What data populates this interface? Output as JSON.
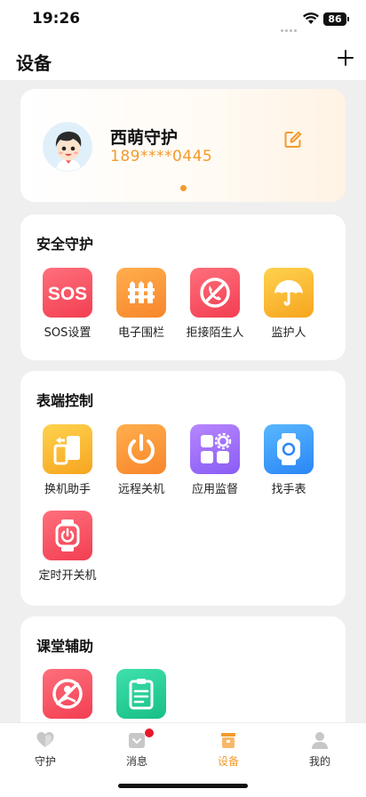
{
  "status_bar": {
    "time": "19:26",
    "battery": "86"
  },
  "header": {
    "title": "设备",
    "add_icon": "plus-icon"
  },
  "profile": {
    "name": "西萌守护",
    "phone": "189****0445",
    "avatar_icon": "child-avatar",
    "edit_icon": "edit-icon",
    "pager": {
      "current": 1,
      "total": 1
    }
  },
  "sections": {
    "safety": {
      "title": "安全守护",
      "items": [
        {
          "label": "SOS设置",
          "icon": "sos-icon",
          "color": "#f23f52"
        },
        {
          "label": "电子围栏",
          "icon": "fence-icon",
          "color": "#f7862a"
        },
        {
          "label": "拒接陌生人",
          "icon": "block-call-icon",
          "color": "#f23f52"
        },
        {
          "label": "监护人",
          "icon": "umbrella-icon",
          "color": "#f6a51f"
        }
      ]
    },
    "watch_control": {
      "title": "表端控制",
      "items": [
        {
          "label": "换机助手",
          "icon": "phone-switch-icon",
          "color": "#f6a51f"
        },
        {
          "label": "远程关机",
          "icon": "power-icon",
          "color": "#f7862a"
        },
        {
          "label": "应用监督",
          "icon": "apps-gear-icon",
          "color": "#8a5cf5"
        },
        {
          "label": "找手表",
          "icon": "watch-icon",
          "color": "#2a86f5"
        },
        {
          "label": "定时开关机",
          "icon": "timer-power-icon",
          "color": "#f23f52"
        }
      ]
    },
    "classroom": {
      "title": "课堂辅助",
      "items": [
        {
          "icon": "no-study-icon",
          "color": "#f23f52"
        },
        {
          "icon": "clipboard-icon",
          "color": "#17bf85"
        }
      ]
    }
  },
  "tab_bar": {
    "tabs": [
      {
        "label": "守护",
        "icon": "heart-icon",
        "active": false
      },
      {
        "label": "消息",
        "icon": "message-icon",
        "active": false,
        "badge": true
      },
      {
        "label": "设备",
        "icon": "device-icon",
        "active": true
      },
      {
        "label": "我的",
        "icon": "user-icon",
        "active": false
      }
    ]
  },
  "colors": {
    "accent": "#f39a2c",
    "badge": "#e8172b",
    "background": "#efefef"
  }
}
